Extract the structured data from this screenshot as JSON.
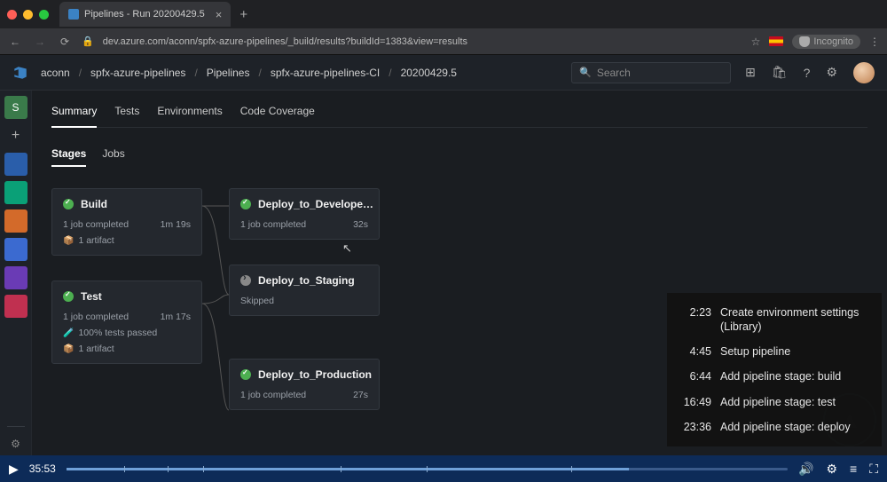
{
  "browser": {
    "tab_title": "Pipelines - Run 20200429.5",
    "url": "dev.azure.com/aconn/spfx-azure-pipelines/_build/results?buildId=1383&view=results",
    "incognito_label": "Incognito"
  },
  "breadcrumbs": [
    "aconn",
    "spfx-azure-pipelines",
    "Pipelines",
    "spfx-azure-pipelines-CI",
    "20200429.5"
  ],
  "search": {
    "placeholder": "Search"
  },
  "run_tabs": [
    "Summary",
    "Tests",
    "Environments",
    "Code Coverage"
  ],
  "run_tabs_active": 0,
  "sub_tabs": [
    "Stages",
    "Jobs"
  ],
  "sub_tabs_active": 0,
  "stages": {
    "build": {
      "name": "Build",
      "status": "success",
      "jobs_text": "1 job completed",
      "duration": "1m 19s",
      "artifact_text": "1 artifact"
    },
    "test": {
      "name": "Test",
      "status": "success",
      "jobs_text": "1 job completed",
      "duration": "1m 17s",
      "tests_text": "100% tests passed",
      "artifact_text": "1 artifact"
    },
    "deploy_dev": {
      "name": "Deploy_to_Develope…",
      "status": "success",
      "jobs_text": "1 job completed",
      "duration": "32s"
    },
    "deploy_staging": {
      "name": "Deploy_to_Staging",
      "status": "skipped",
      "status_text": "Skipped"
    },
    "deploy_prod": {
      "name": "Deploy_to_Production",
      "status": "success",
      "jobs_text": "1 job completed",
      "duration": "27s"
    }
  },
  "rail_items": [
    {
      "label": "S",
      "bg": "#3a7a4a",
      "text": "S"
    },
    {
      "label": "+",
      "bg": "transparent",
      "text": "+"
    },
    {
      "label": "boards",
      "bg": "#2a5eaa",
      "text": ""
    },
    {
      "label": "repos",
      "bg": "#0aa077",
      "text": ""
    },
    {
      "label": "pipelines",
      "bg": "#d36a2a",
      "text": ""
    },
    {
      "label": "test",
      "bg": "#3b6ad0",
      "text": ""
    },
    {
      "label": "artifacts",
      "bg": "#6a3bb5",
      "text": ""
    },
    {
      "label": "other",
      "bg": "#c03050",
      "text": ""
    }
  ],
  "chapters": [
    {
      "t": "2:23",
      "title": "Create environment settings (Library)"
    },
    {
      "t": "4:45",
      "title": "Setup pipeline"
    },
    {
      "t": "6:44",
      "title": "Add pipeline stage: build"
    },
    {
      "t": "16:49",
      "title": "Add pipeline stage: test"
    },
    {
      "t": "23:36",
      "title": "Add pipeline stage: deploy"
    }
  ],
  "player": {
    "time": "35:53"
  }
}
